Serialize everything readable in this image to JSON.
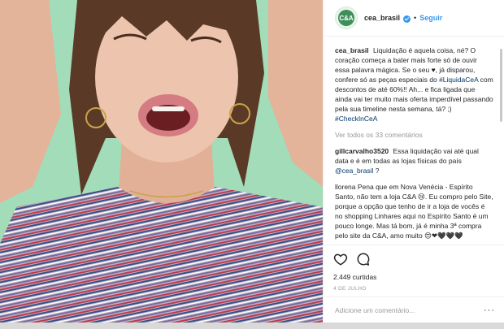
{
  "post": {
    "username": "cea_brasil",
    "follow_label": "Seguir",
    "separator": "•",
    "avatar_text": "C&A"
  },
  "caption": {
    "username": "cea_brasil",
    "text_1": "Liquidação é aquela coisa, né? O coração começa a bater mais forte só de ouvir essa palavra mágica. Se o seu",
    "heart": "♥",
    "text_2": ", já disparou, confere só as peças especiais do",
    "hashtag_1": "#LiquidaCeA",
    "text_3": "com descontos de até 60%!! Ah... e fica ligada que ainda vai ter muito mais oferta imperdível passando pela sua timeline nesta semana, tá? ;)",
    "hashtag_2": "#CheckInCeA"
  },
  "view_all_comments": "Ver todos os 33 comentários",
  "comments": [
    {
      "username": "gillcarvalho3520",
      "text": "Essa liquidação vai até qual data e é em todas as lojas físicas do país",
      "mention": "@cea_brasil",
      "suffix": "?"
    },
    {
      "username": "",
      "text": "llorena Pena que em Nova Venécia - Espírito Santo, não tem a loja C&A 😢. Eu compro pelo Site, porque a opção que tenho de ir a loja de vocês é no shopping Linhares aqui no Espírito Santo é um pouco longe. Mas tá bom, já é minha 3ª compra pelo site da C&A, amo muito 😍❤🖤🖤🖤",
      "mention": "",
      "suffix": ""
    }
  ],
  "likes": {
    "count": "2.449",
    "label": "curtidas"
  },
  "date": "4 DE JULHO",
  "add_comment": {
    "placeholder": "Adicione um comentário..."
  },
  "more_label": "···",
  "icons": [
    "heart-icon",
    "comment-icon",
    "ellipsis-icon",
    "verified-icon"
  ],
  "colors": {
    "background": "#a3dcb8",
    "accent": "#3897f0",
    "hashtag": "#003569"
  }
}
